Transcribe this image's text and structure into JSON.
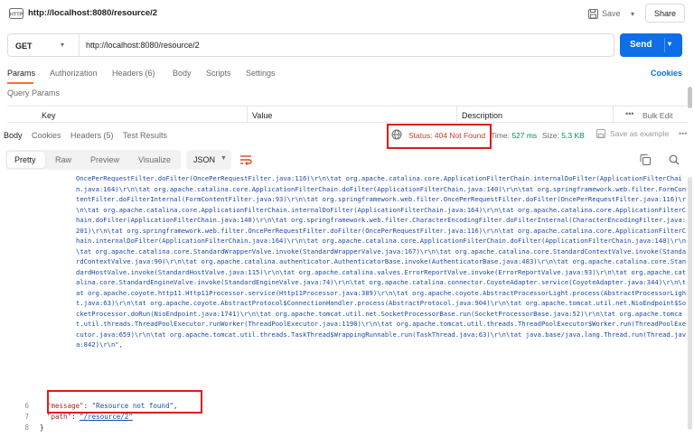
{
  "topbar": {
    "http_badge": "HTTP",
    "title": "http://localhost:8080/resource/2",
    "save_label": "Save",
    "share_label": "Share"
  },
  "request": {
    "method": "GET",
    "url": "http://localhost:8080/resource/2",
    "send_label": "Send"
  },
  "request_tabs": {
    "items": [
      "Params",
      "Authorization",
      "Headers (6)",
      "Body",
      "Scripts",
      "Settings"
    ],
    "cookies_label": "Cookies"
  },
  "query_params": {
    "title": "Query Params",
    "columns": [
      "Key",
      "Value",
      "Description"
    ],
    "bulk_edit_label": "Bulk Edit"
  },
  "response": {
    "tabs": [
      "Body",
      "Cookies",
      "Headers (5)",
      "Test Results"
    ],
    "status_label": "Status:",
    "status_value": "404 Not Found",
    "time_label": "Time:",
    "time_value": "527 ms",
    "size_label": "Size:",
    "size_value": "5.3 KB",
    "save_example_label": "Save as example"
  },
  "view": {
    "tabs": [
      "Pretty",
      "Raw",
      "Preview",
      "Visualize"
    ],
    "format": "JSON"
  },
  "code": {
    "trace": "OncePerRequestFilter.doFilter(OncePerRequestFilter.java:116)\\r\\n\\tat org.apache.catalina.core.ApplicationFilterChain.internalDoFilter(ApplicationFilterChain.java:164)\\r\\n\\tat org.apache.catalina.core.ApplicationFilterChain.doFilter(ApplicationFilterChain.java:140)\\r\\n\\tat org.springframework.web.filter.FormContentFilter.doFilterInternal(FormContentFilter.java:93)\\r\\n\\tat org.springframework.web.filter.OncePerRequestFilter.doFilter(OncePerRequestFilter.java:116)\\r\\n\\tat org.apache.catalina.core.ApplicationFilterChain.internalDoFilter(ApplicationFilterChain.java:164)\\r\\n\\tat org.apache.catalina.core.ApplicationFilterChain.doFilter(ApplicationFilterChain.java:140)\\r\\n\\tat org.springframework.web.filter.CharacterEncodingFilter.doFilterInternal(CharacterEncodingFilter.java:201)\\r\\n\\tat org.springframework.web.filter.OncePerRequestFilter.doFilter(OncePerRequestFilter.java:116)\\r\\n\\tat org.apache.catalina.core.ApplicationFilterChain.internalDoFilter(ApplicationFilterChain.java:164)\\r\\n\\tat org.apache.catalina.core.ApplicationFilterChain.doFilter(ApplicationFilterChain.java:140)\\r\\n\\tat org.apache.catalina.core.StandardWrapperValve.invoke(StandardWrapperValve.java:167)\\r\\n\\tat org.apache.catalina.core.StandardContextValve.invoke(StandardContextValve.java:90)\\r\\n\\tat org.apache.catalina.authenticator.AuthenticatorBase.invoke(AuthenticatorBase.java:483)\\r\\n\\tat org.apache.catalina.core.StandardHostValve.invoke(StandardHostValve.java:115)\\r\\n\\tat org.apache.catalina.valves.ErrorReportValve.invoke(ErrorReportValve.java:93)\\r\\n\\tat org.apache.catalina.core.StandardEngineValve.invoke(StandardEngineValve.java:74)\\r\\n\\tat org.apache.catalina.connector.CoyoteAdapter.service(CoyoteAdapter.java:344)\\r\\n\\tat org.apache.coyote.http11.Http11Processor.service(Http11Processor.java:389)\\r\\n\\tat org.apache.coyote.AbstractProcessorLight.process(AbstractProcessorLight.java:63)\\r\\n\\tat org.apache.coyote.AbstractProtocol$ConnectionHandler.process(AbstractProtocol.java:904)\\r\\n\\tat org.apache.tomcat.util.net.NioEndpoint$SocketProcessor.doRun(NioEndpoint.java:1741)\\r\\n\\tat org.apache.tomcat.util.net.SocketProcessorBase.run(SocketProcessorBase.java:52)\\r\\n\\tat org.apache.tomcat.util.threads.ThreadPoolExecutor.runWorker(ThreadPoolExecutor.java:1190)\\r\\n\\tat org.apache.tomcat.util.threads.ThreadPoolExecutor$Worker.run(ThreadPoolExecutor.java:659)\\r\\n\\tat org.apache.tomcat.util.threads.TaskThread$WrappingRunnable.run(TaskThread.java:63)\\r\\n\\tat java.base/java.lang.Thread.run(Thread.java:842)\\r\\n\",",
    "lines": [
      {
        "num": "6",
        "key": "\"message\"",
        "sep": ": ",
        "value": "\"Resource not found\"",
        "end": ","
      },
      {
        "num": "7",
        "key": "\"path\"",
        "sep": ": ",
        "value": "\"/resource/2\"",
        "end": ""
      },
      {
        "num": "8",
        "text": "}"
      }
    ]
  },
  "colors": {
    "accent": "#0d6ee8",
    "active_tab": "#ff6c37",
    "status_error": "#c43d2b",
    "highlight_box": "#e01a1a"
  }
}
